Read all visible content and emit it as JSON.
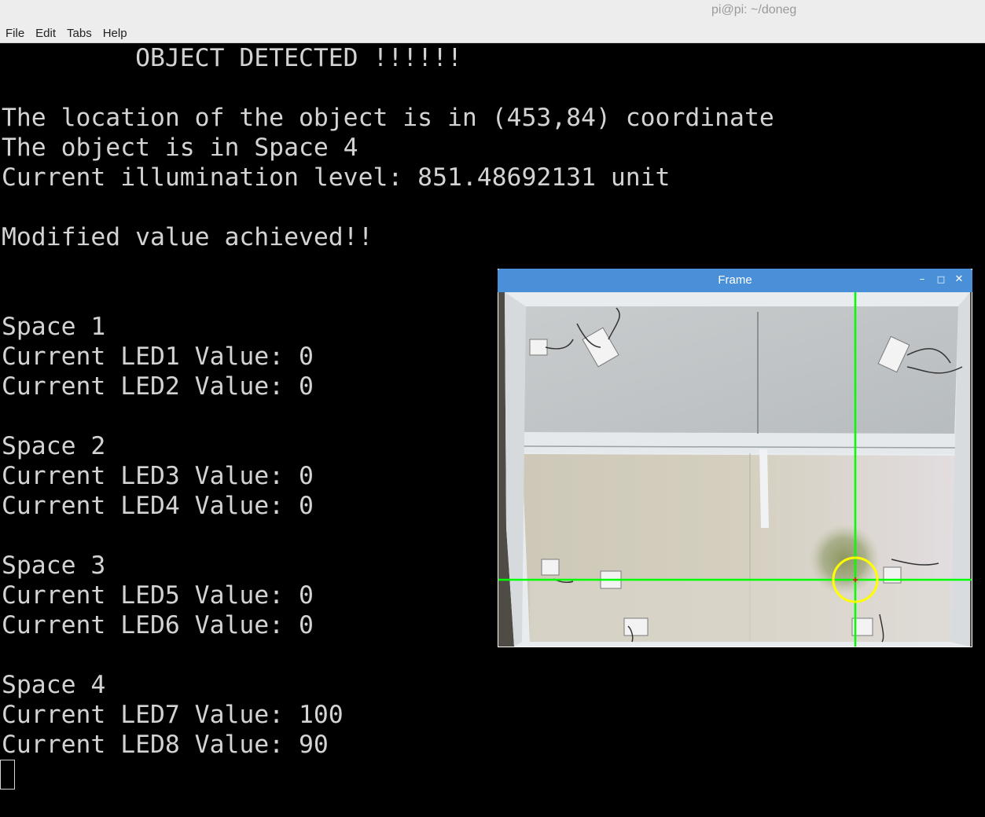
{
  "window": {
    "title": "pi@pi: ~/doneg"
  },
  "menu": {
    "items": [
      "File",
      "Edit",
      "Tabs",
      "Help"
    ]
  },
  "terminal": {
    "lines": [
      "         OBJECT DETECTED !!!!!!",
      "",
      "The location of the object is in (453,84) coordinate",
      "The object is in Space 4",
      "Current illumination level: 851.48692131 unit",
      "",
      "Modified value achieved!!",
      "",
      "",
      "Space 1",
      "Current LED1 Value: 0",
      "Current LED2 Value: 0",
      "",
      "Space 2",
      "Current LED3 Value: 0",
      "Current LED4 Value: 0",
      "",
      "Space 3",
      "Current LED5 Value: 0",
      "Current LED6 Value: 0",
      "",
      "Space 4",
      "Current LED7 Value: 100",
      "Current LED8 Value: 90"
    ]
  },
  "frame_window": {
    "title": "Frame",
    "minimize_icon": "minimize-icon",
    "maximize_icon": "maximize-icon",
    "close_icon": "close-icon",
    "titlebar_color": "#4a90d9",
    "crosshair_color": "#00ff00",
    "marker_circle_color": "#ffff00",
    "marker_center_color": "#ff0000"
  }
}
